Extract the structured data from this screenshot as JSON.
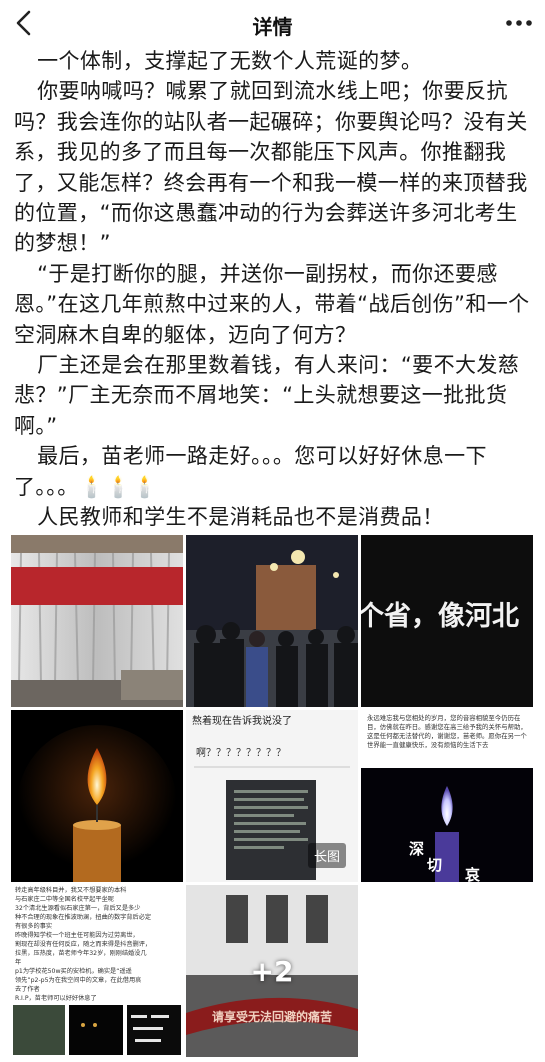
{
  "header": {
    "title": "详情",
    "back_icon": "chevron-left-icon",
    "more_icon": "more-horizontal-icon"
  },
  "article": {
    "paragraphs": [
      "一个体制，支撑起了无数个人荒诞的梦。",
      "你要呐喊吗？喊累了就回到流水线上吧；你要反抗吗？我会连你的站队者一起碾碎；你要舆论吗？没有关系，我见的多了而且每一次都能压下风声。你推翻我了，又能怎样？终会再有一个和我一模一样的来顶替我的位置，“而你这愚蠢冲动的行为会葬送许多河北考生的梦想！”",
      "“于是打断你的腿，并送你一副拐杖，而你还要感恩。”在这几年煎熬中过来的人，带着“战后创伤”和一个空洞麻木自卑的躯体，迈向了何方？",
      "厂主还是会在那里数着钱，有人来问：“要不大发慈悲？”厂主无奈而不屑地笑：“上头就想要这一批批货啊。”",
      "最后，苗老师一路走好。。。您可以好好休息一下了。。。🕯️🕯️🕯️",
      "人民教师和学生不是消耗品也不是消费品！"
    ]
  },
  "images": {
    "img3_caption": "个省，像河北",
    "img5_header": "熬着现在告诉我说没了",
    "img5_question": "啊？？？？？？？？",
    "img5_badge": "长图",
    "img6_text": "永远难忘我与您相处的岁月，您的音容相貌至今仍历在目，仿佛就在昨日。感谢您在高三给予我的关怀与帮助，这是任何都无法替代的，谢谢您，苗老师。愿你在另一个世界能一直健康快乐，没有烦恼的生活下去",
    "img6_chars": [
      "深",
      "切",
      "哀"
    ],
    "img7_lines": [
      "转走高年级科目并，我又不想要家的本科",
      "与石家庄二中等全国名校平起平坐呢",
      "32个清北生源看似石家庄第一，背后又是多少",
      "种不合理的现象在推波助澜，扭曲的数字背后必定",
      "有很多的事实",
      "昨晚得知学校一个班主任可能因为过劳离世，",
      "割现在却没有任何反应，随之而来得是抖音删评，",
      "拉黑，压热度，苗老师今年32岁，刚刚结婚没几",
      "年",
      "p1为学校花50w买的安检机，确实是“遥遥",
      "领先”p2-p5为在我空间中的文章，在此借用哀",
      "去了作者",
      "R.I.P，苗老师可以好好休息了"
    ],
    "img8_banner": "请享受无法回避的痛苦",
    "more_count": "+2"
  },
  "colors": {
    "curtain_red": "#b8262c",
    "candle_flame": "#f5a623",
    "text": "#1a1a1a"
  }
}
